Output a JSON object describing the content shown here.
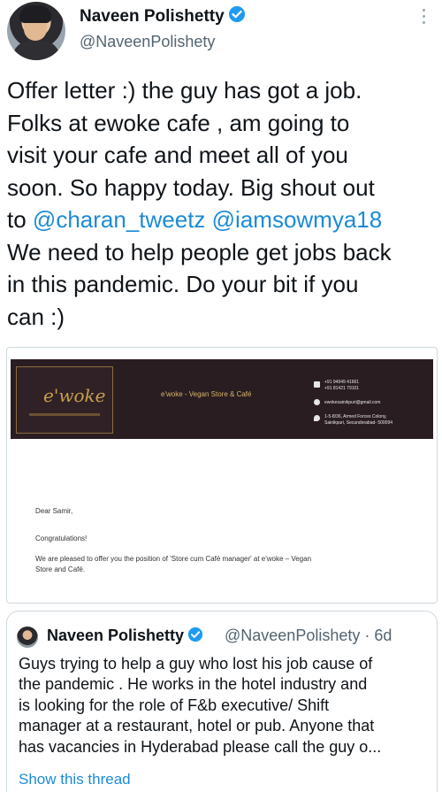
{
  "author": {
    "name": "Naveen Polishetty",
    "handle": "@NaveenPolishety",
    "avatar_icon": "profile-photo",
    "verified_icon": "verified-badge-icon"
  },
  "tweet": {
    "line1": "Offer letter :) the guy has got a job.",
    "line2": "Folks at ewoke cafe , am going to",
    "line3": "visit your cafe and meet all of you",
    "line4": "soon. So happy today. Big shout out",
    "line5_pre": "to ",
    "mention1": "@charan_tweetz",
    "line5_mid": " ",
    "mention2": "@iamsowmya18",
    "line6": "We need to help people get jobs back",
    "line7": "in this pandemic. Do your bit if you",
    "line8": "can :)"
  },
  "letter": {
    "logo_text": "e'woke",
    "store_name": "e'woke - Vegan Store & Café",
    "phone1": "+91 94949 41661",
    "phone2": "+91 81421 79101",
    "email": "ewokesainikpuri@gmail.com",
    "address1": "1-5-8/36, Armed Forces Colony,",
    "address2": "Sainikpuri, Secunderabad- 500094",
    "greeting": "Dear Samir,",
    "congrats": "Congratulations!",
    "body1": "We are pleased to offer you the position of 'Store cum Café manager' at e'woke – Vegan",
    "body2": "Store and Café."
  },
  "quoted": {
    "name": "Naveen Polishetty",
    "handle": "@NaveenPolishety · 6d",
    "line1": "Guys trying to help a guy who lost his job cause of",
    "line2": "the pandemic . He works in the hotel industry and",
    "line3": "is looking for the role of F&b executive/ Shift",
    "line4": "manager at a restaurant, hotel or pub. Anyone that",
    "line5": "has vacancies in Hyderabad please call the guy o...",
    "show_thread": "Show this thread"
  },
  "colors": {
    "accent": "#1b8bd6",
    "verified": "#1d9bf0",
    "banner": "#2a1d22",
    "gold": "#c9a04a"
  }
}
